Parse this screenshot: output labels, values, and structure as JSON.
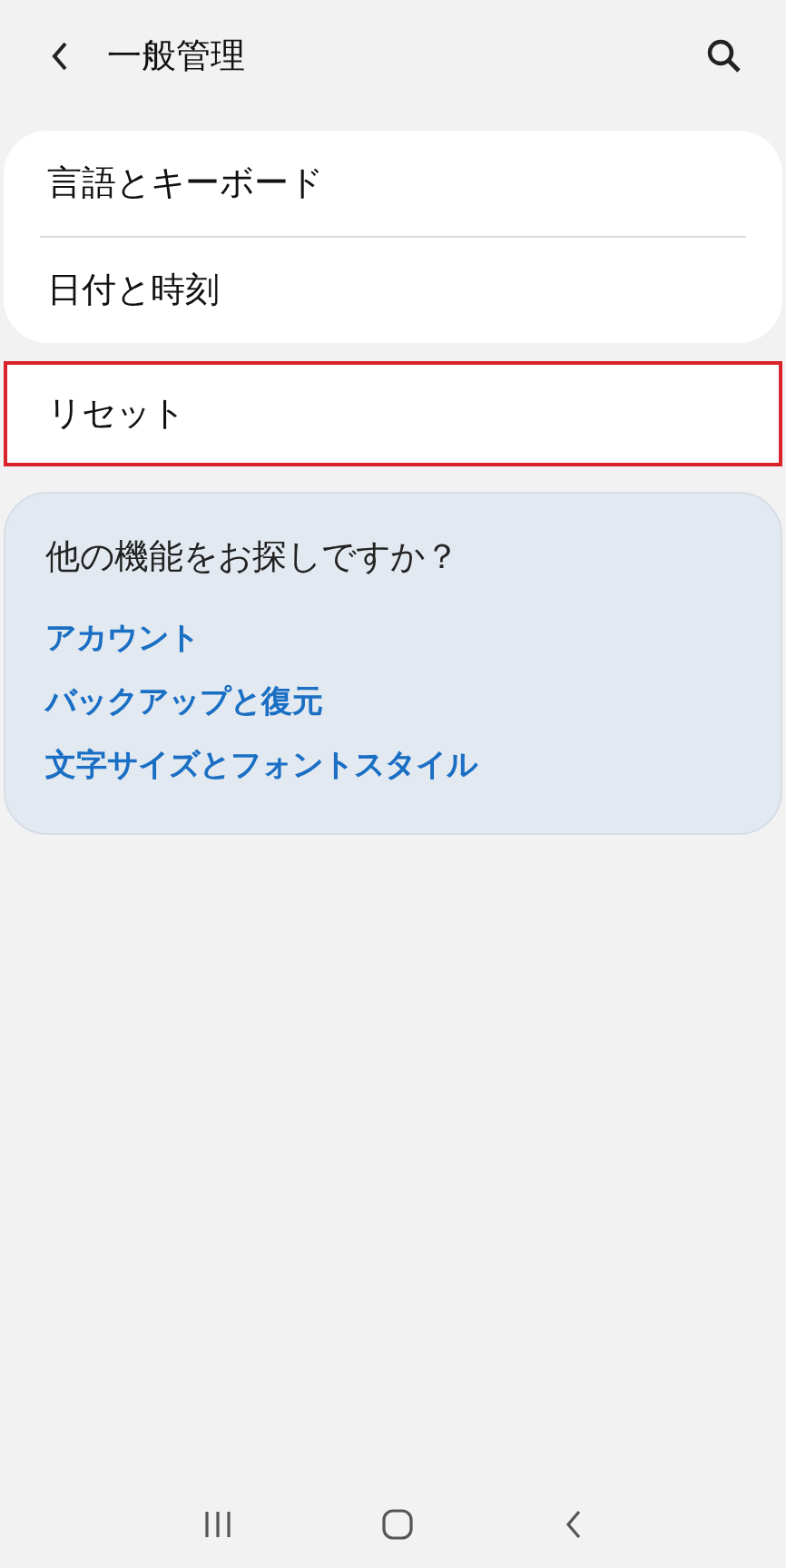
{
  "header": {
    "title": "一般管理"
  },
  "groups": [
    {
      "items": [
        {
          "label": "言語とキーボード",
          "highlighted": false
        },
        {
          "label": "日付と時刻",
          "highlighted": false
        }
      ]
    },
    {
      "items": [
        {
          "label": "リセット",
          "highlighted": true
        }
      ]
    }
  ],
  "suggestions": {
    "title": "他の機能をお探しですか？",
    "links": [
      "アカウント",
      "バックアップと復元",
      "文字サイズとフォントスタイル"
    ]
  }
}
